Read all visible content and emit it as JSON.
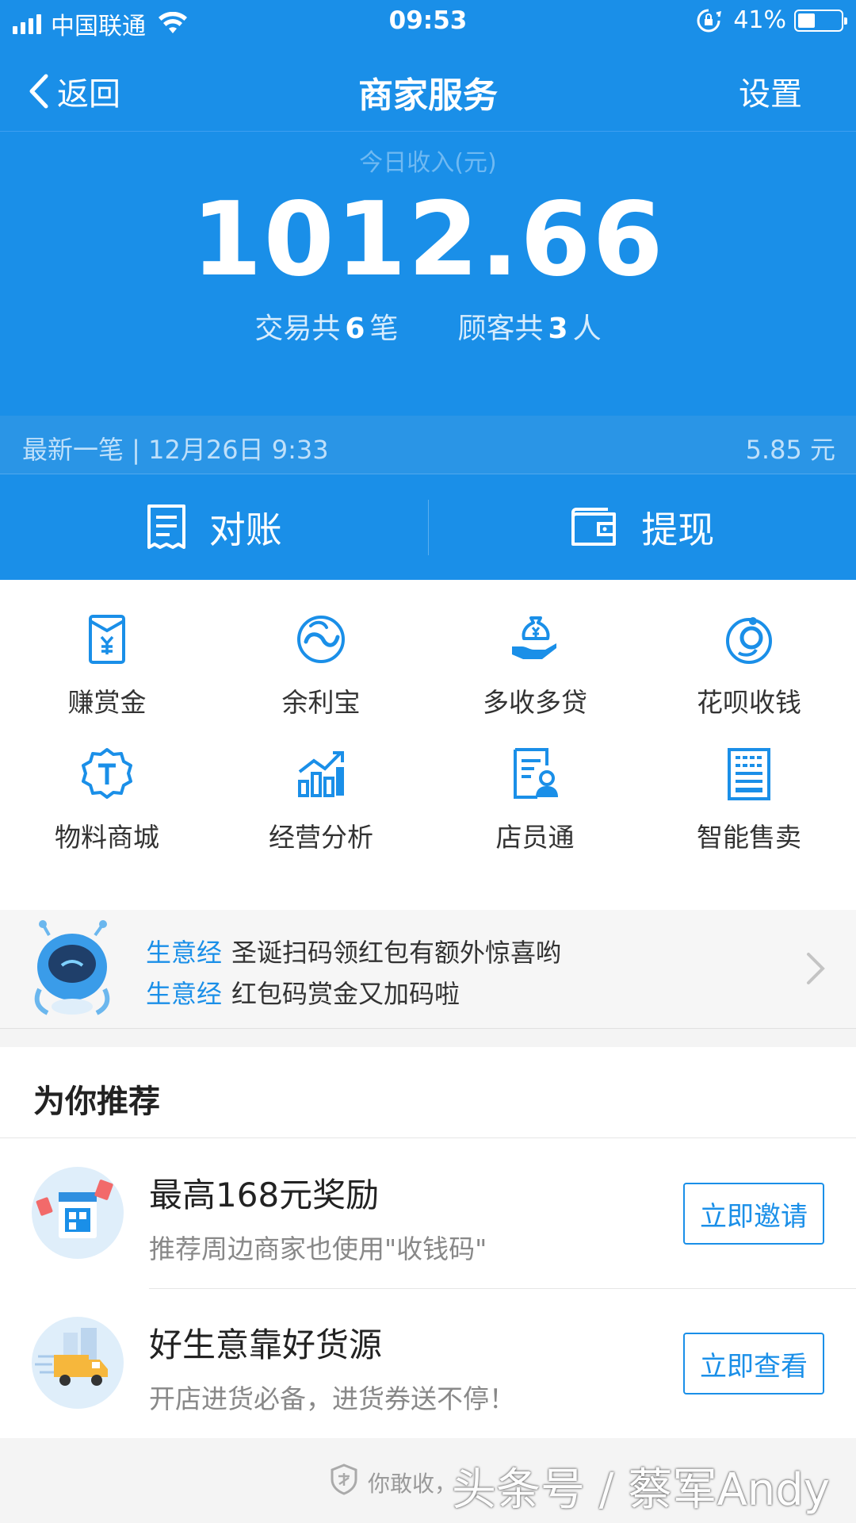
{
  "status_bar": {
    "carrier": "中国联通",
    "time": "09:53",
    "battery": "41%",
    "battery_level": 0.41
  },
  "navbar": {
    "back_label": "返回",
    "title": "商家服务",
    "settings_label": "设置"
  },
  "income": {
    "label": "今日收入(元)",
    "amount": "1012.66",
    "transactions_prefix": "交易共",
    "transactions_count": "6",
    "transactions_suffix": "笔",
    "customers_prefix": "顾客共",
    "customers_count": "3",
    "customers_suffix": "人"
  },
  "latest": {
    "label": "最新一笔 | 12月26日 9:33",
    "amount": "5.85 元"
  },
  "actions": {
    "reconcile_label": "对账",
    "withdraw_label": "提现"
  },
  "services": [
    {
      "label": "赚赏金",
      "icon": "reward-envelope-icon"
    },
    {
      "label": "余利宝",
      "icon": "yulibao-icon"
    },
    {
      "label": "多收多贷",
      "icon": "money-bag-hand-icon"
    },
    {
      "label": "花呗收钱",
      "icon": "huabei-icon"
    },
    {
      "label": "物料商城",
      "icon": "badge-t-icon"
    },
    {
      "label": "经营分析",
      "icon": "bar-chart-icon"
    },
    {
      "label": "店员通",
      "icon": "staff-document-icon"
    },
    {
      "label": "智能售卖",
      "icon": "vending-machine-icon"
    }
  ],
  "news": {
    "items": [
      {
        "tag": "生意经",
        "text": "圣诞扫码领红包有额外惊喜哟"
      },
      {
        "tag": "生意经",
        "text": "红包码赏金又加码啦"
      }
    ]
  },
  "recommend": {
    "title": "为你推荐",
    "items": [
      {
        "title": "最高168元奖励",
        "subtitle": "推荐周边商家也使用\"收钱码\"",
        "button": "立即邀请",
        "icon": "payment-code-icon"
      },
      {
        "title": "好生意靠好货源",
        "subtitle": "开店进货必备，进货券送不停！",
        "button": "立即查看",
        "icon": "delivery-truck-icon"
      }
    ]
  },
  "footer": {
    "text": "你敢收，",
    "watermark": "头条号 / 蔡军Andy"
  },
  "colors": {
    "brand_blue": "#1a8fe8",
    "latest_bar": "#2a95e6"
  }
}
